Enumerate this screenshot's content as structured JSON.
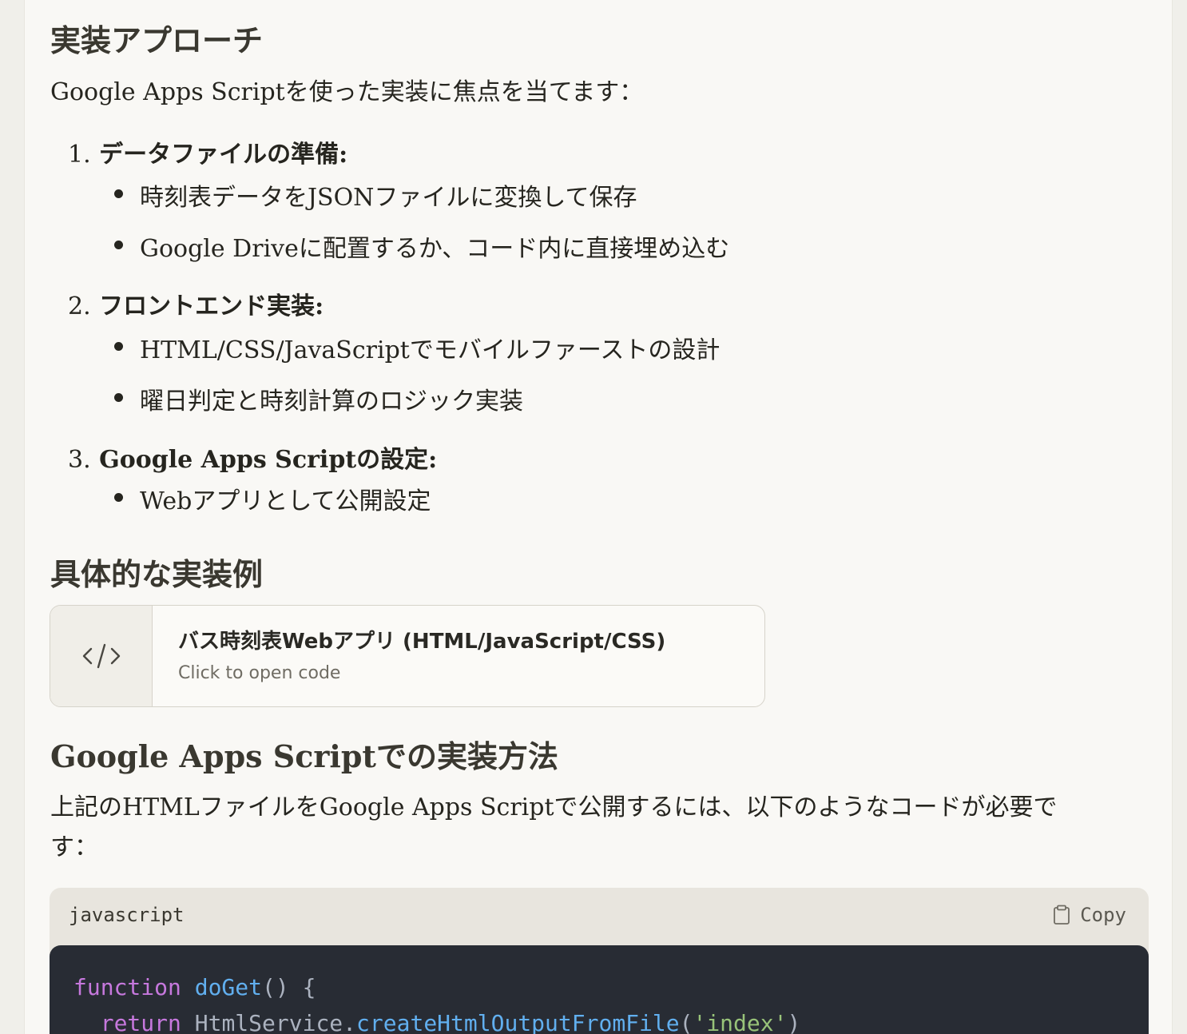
{
  "section1": {
    "heading": "実装アプローチ",
    "intro": "Google Apps Scriptを使った実装に焦点を当てます：",
    "steps": [
      {
        "number": "1.",
        "title": "データファイルの準備:",
        "items": [
          "時刻表データをJSONファイルに変換して保存",
          "Google Driveに配置するか、コード内に直接埋め込む"
        ]
      },
      {
        "number": "2.",
        "title": "フロントエンド実装:",
        "items": [
          "HTML/CSS/JavaScriptでモバイルファーストの設計",
          "曜日判定と時刻計算のロジック実装"
        ]
      },
      {
        "number": "3.",
        "title": "Google Apps Scriptの設定:",
        "items": [
          "Webアプリとして公開設定"
        ]
      }
    ]
  },
  "section2": {
    "heading": "具体的な実装例",
    "artifact": {
      "icon": "code-brackets-icon",
      "title": "バス時刻表Webアプリ (HTML/JavaScript/CSS)",
      "subtitle": "Click to open code"
    }
  },
  "section3": {
    "heading": "Google Apps Scriptでの実装方法",
    "text_line1": "上記のHTMLファイルをGoogle Apps Scriptで公開するには、以下のようなコードが必要で",
    "text_line2": "す：",
    "code": {
      "language": "javascript",
      "copy_label": "Copy",
      "copy_icon": "clipboard-icon",
      "line1": {
        "kw": "function",
        "fn": "doGet",
        "rest": "() {"
      },
      "line2": {
        "kw": "return",
        "obj": " HtmlService.",
        "fn": "createHtmlOutputFromFile",
        "open": "(",
        "str": "'index'",
        "close": ")"
      }
    }
  },
  "colors": {
    "background": "#f0efea",
    "panel": "#f9f8f5",
    "code_bg": "#282c34",
    "keyword": "#c678dd",
    "function": "#61afef",
    "string": "#98c379"
  }
}
